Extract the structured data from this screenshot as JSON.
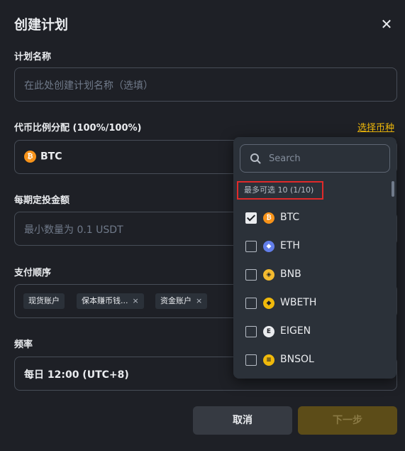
{
  "header": {
    "title": "创建计划",
    "close_icon": "close-icon"
  },
  "plan_name": {
    "label": "计划名称",
    "placeholder": "在此处创建计划名称（选填）"
  },
  "allocation": {
    "label": "代币比例分配 (100%/100%)",
    "select_link": "选择币种",
    "selected_coin": "BTC",
    "selected_icon": "btc-icon"
  },
  "amount": {
    "label": "每期定投金额",
    "placeholder": "最小数量为 0.1 USDT"
  },
  "payment": {
    "label": "支付顺序",
    "tags": [
      {
        "label": "现货账户",
        "removable": false
      },
      {
        "label": "保本赚币钱...",
        "removable": true
      },
      {
        "label": "资金账户",
        "removable": true
      }
    ],
    "remove_icon": "×"
  },
  "frequency": {
    "label": "频率",
    "value": "每日 12:00 (UTC+8)"
  },
  "buttons": {
    "cancel": "取消",
    "next": "下一步"
  },
  "dropdown": {
    "search_placeholder": "Search",
    "limit_text": "最多可选 10 (1/10)",
    "options": [
      {
        "name": "BTC",
        "checked": true,
        "icon": "btc-icon",
        "glyph": "₿"
      },
      {
        "name": "ETH",
        "checked": false,
        "icon": "eth-icon",
        "glyph": "◆"
      },
      {
        "name": "BNB",
        "checked": false,
        "icon": "bnb-icon",
        "glyph": "◈"
      },
      {
        "name": "WBETH",
        "checked": false,
        "icon": "wbeth-icon",
        "glyph": "◆"
      },
      {
        "name": "EIGEN",
        "checked": false,
        "icon": "eigen-icon",
        "glyph": "E"
      },
      {
        "name": "BNSOL",
        "checked": false,
        "icon": "bnsol-icon",
        "glyph": "≡"
      }
    ]
  },
  "colors": {
    "background": "#1e2026",
    "accent": "#f0b90b",
    "highlight_border": "#e02a2a",
    "dropdown_bg": "#2b3139"
  }
}
